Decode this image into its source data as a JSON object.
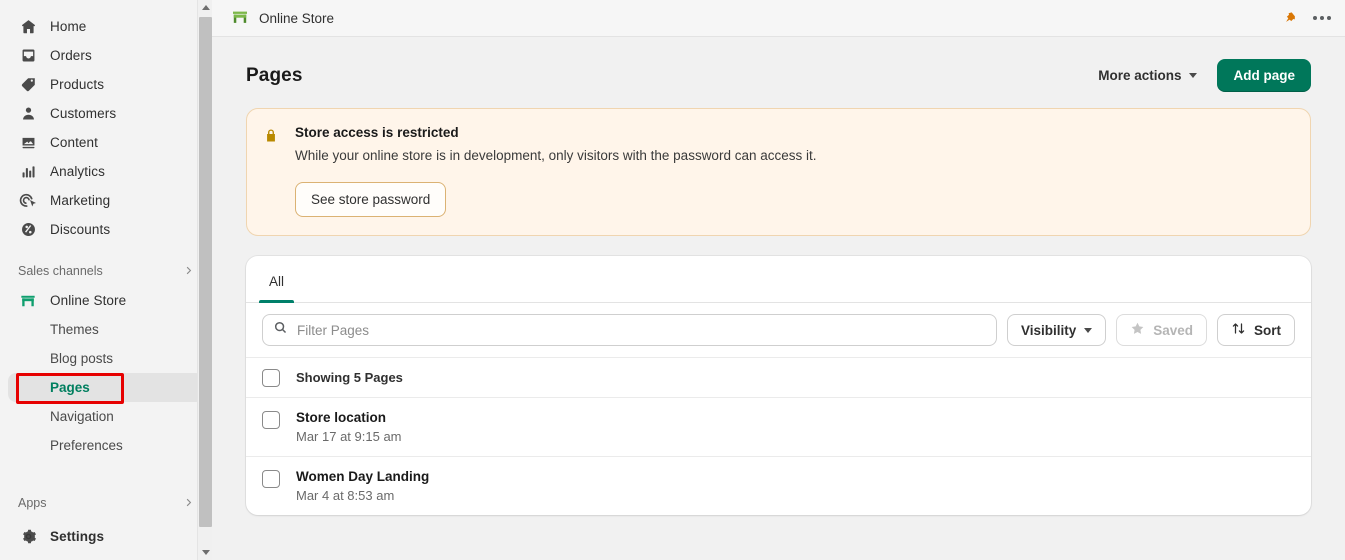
{
  "sidebar": {
    "nav": [
      {
        "label": "Home",
        "icon": "home-icon"
      },
      {
        "label": "Orders",
        "icon": "orders-icon"
      },
      {
        "label": "Products",
        "icon": "products-tag-icon"
      },
      {
        "label": "Customers",
        "icon": "customers-person-icon"
      },
      {
        "label": "Content",
        "icon": "content-image-icon"
      },
      {
        "label": "Analytics",
        "icon": "analytics-bars-icon"
      },
      {
        "label": "Marketing",
        "icon": "marketing-target-icon"
      },
      {
        "label": "Discounts",
        "icon": "discounts-percent-icon"
      }
    ],
    "sales_channels": {
      "label": "Sales channels",
      "chevron": "chevron-right-icon"
    },
    "online_store": {
      "label": "Online Store",
      "icon": "storefront-icon"
    },
    "online_store_children": [
      {
        "label": "Themes",
        "active": false
      },
      {
        "label": "Blog posts",
        "active": false
      },
      {
        "label": "Pages",
        "active": true
      },
      {
        "label": "Navigation",
        "active": false
      },
      {
        "label": "Preferences",
        "active": false
      }
    ],
    "apps": {
      "label": "Apps",
      "chevron": "chevron-right-icon"
    },
    "settings": {
      "label": "Settings",
      "icon": "gear-icon"
    },
    "active_highlight_color": "#e60000",
    "active_text_color": "#007f5f"
  },
  "topbar": {
    "title": "Online Store",
    "store_icon": "storefront-icon",
    "pin_icon": "pin-icon",
    "pin_color": "#d97706",
    "more_icon": "ellipsis-icon"
  },
  "header": {
    "title": "Pages",
    "more_actions_label": "More actions",
    "add_page_label": "Add page",
    "primary_color": "#00775a"
  },
  "banner": {
    "icon": "lock-icon",
    "title": "Store access is restricted",
    "text": "While your online store is in development, only visitors with the password can access it.",
    "button_label": "See store password",
    "background": "#fff5ea",
    "border_color": "#f0d5b0",
    "icon_color": "#b98900"
  },
  "card": {
    "tabs": [
      {
        "label": "All",
        "active": true
      }
    ],
    "tab_accent": "#00806a",
    "search": {
      "placeholder": "Filter Pages",
      "value": "",
      "icon": "search-icon"
    },
    "visibility_label": "Visibility",
    "saved_label": "Saved",
    "saved_icon": "star-icon",
    "sort_label": "Sort",
    "sort_icon": "sort-arrows-icon",
    "showing_label": "Showing 5 Pages",
    "rows": [
      {
        "title": "Store location",
        "date": "Mar 17 at 9:15 am"
      },
      {
        "title": "Women Day Landing",
        "date": "Mar 4 at 8:53 am"
      }
    ]
  }
}
